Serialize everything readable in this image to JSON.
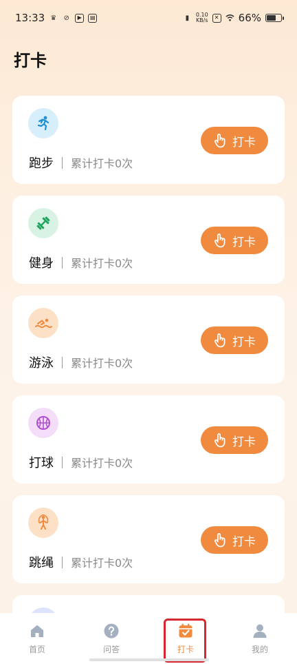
{
  "status": {
    "time": "13:33",
    "net_top": "0.10",
    "net_bottom": "KB/s",
    "battery": "66%",
    "battery_level": 0.66
  },
  "page": {
    "title": "打卡"
  },
  "items": [
    {
      "name": "跑步",
      "count": "累计打卡0次",
      "button": "打卡",
      "icon": "running-icon",
      "icon_bg": "#d7eefb",
      "icon_color": "#1f8fd4"
    },
    {
      "name": "健身",
      "count": "累计打卡0次",
      "button": "打卡",
      "icon": "dumbbell-icon",
      "icon_bg": "#d8f3e4",
      "icon_color": "#1ea35d"
    },
    {
      "name": "游泳",
      "count": "累计打卡0次",
      "button": "打卡",
      "icon": "swimming-icon",
      "icon_bg": "#fde1c6",
      "icon_color": "#f08a3e"
    },
    {
      "name": "打球",
      "count": "累计打卡0次",
      "button": "打卡",
      "icon": "basketball-icon",
      "icon_bg": "#f4ddf8",
      "icon_color": "#b04ed0"
    },
    {
      "name": "跳绳",
      "count": "累计打卡0次",
      "button": "打卡",
      "icon": "jumprope-icon",
      "icon_bg": "#fde1c6",
      "icon_color": "#f08a3e"
    }
  ],
  "tabs": [
    {
      "label": "首页",
      "icon": "home-icon",
      "active": false
    },
    {
      "label": "问答",
      "icon": "question-icon",
      "active": false
    },
    {
      "label": "打卡",
      "icon": "calendar-check-icon",
      "active": true
    },
    {
      "label": "我的",
      "icon": "user-icon",
      "active": false
    }
  ],
  "colors": {
    "accent": "#f08a3e",
    "highlight": "#d6262e",
    "background": "#fdf0e2"
  }
}
